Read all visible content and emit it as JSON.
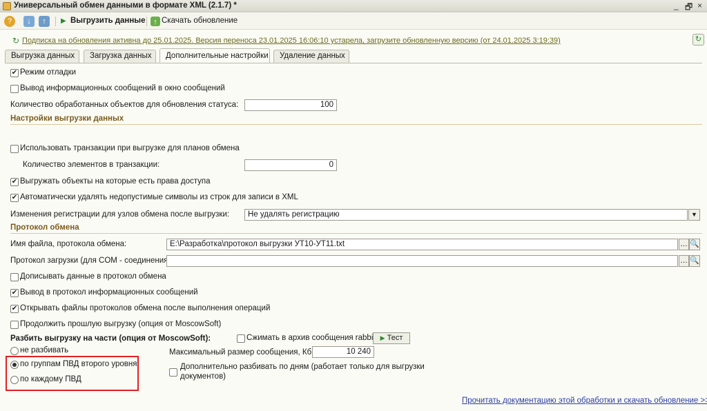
{
  "window": {
    "title": "Универсальный обмен данными в формате XML (2.1.7) *",
    "minimize_icon": "minimize-icon",
    "restore_icon": "restore-icon",
    "close_icon": "close-icon",
    "min_glyph": "_",
    "restore_glyph": "🗗",
    "close_glyph": "×"
  },
  "toolbar": {
    "export_label": "Выгрузить данные",
    "download_update_label": "Скачать обновление"
  },
  "notice": {
    "text": "Подписка на обновления активна до 25.01.2025. Версия переноса 23.01.2025 16:06:10 устарела, загрузите обновленную версию (от 24.01.2025 3:19:39)"
  },
  "tabs": [
    {
      "label": "Выгрузка данных"
    },
    {
      "label": "Загрузка данных"
    },
    {
      "label": "Дополнительные настройки"
    },
    {
      "label": "Удаление данных"
    }
  ],
  "settings": {
    "debug_mode": {
      "label": "Режим отладки",
      "checked": true
    },
    "info_messages": {
      "label": "Вывод информационных сообщений в окно сообщений",
      "checked": false
    },
    "processed_count": {
      "label": "Количество обработанных объектов для обновления статуса:",
      "value": "100"
    }
  },
  "export_settings": {
    "header": "Настройки выгрузки данных",
    "use_transactions": {
      "label": "Использовать транзакции при выгрузке для планов обмена",
      "checked": false
    },
    "transaction_items": {
      "label": "Количество элементов в транзакции:",
      "value": "0"
    },
    "export_with_rights": {
      "label": "Выгружать объекты на которые есть права доступа",
      "checked": true
    },
    "remove_invalid_chars": {
      "label": "Автоматически удалять недопустимые символы из строк для записи в XML",
      "checked": true
    },
    "registration_changes": {
      "label": "Изменения регистрации для узлов обмена после выгрузки:",
      "value": "Не удалять регистрацию"
    }
  },
  "protocol": {
    "header": "Протокол обмена",
    "file_name": {
      "label": "Имя файла, протокола обмена:",
      "value": "E:\\Разработка\\протокол выгрузки УТ10-УТ11.txt"
    },
    "com_protocol": {
      "label": "Протокол загрузки (для COM - соединения):",
      "value": ""
    },
    "append_data": {
      "label": "Дописывать данные в протокол обмена",
      "checked": false
    },
    "info_to_protocol": {
      "label": "Вывод в протокол информационных сообщений",
      "checked": true
    },
    "open_files": {
      "label": "Открывать файлы протоколов обмена после выполнения операций",
      "checked": true
    },
    "continue_export": {
      "label": "Продолжить прошлую выгрузку (опция от MoscowSoft)",
      "checked": false
    }
  },
  "split": {
    "header": "Разбить выгрузку на части (опция от MoscowSoft):",
    "options": [
      {
        "label": "не разбивать",
        "selected": false
      },
      {
        "label": "по группам ПВД второго уровня",
        "selected": true
      },
      {
        "label": "по каждому ПВД",
        "selected": false
      }
    ],
    "compress": {
      "label": "Сжимать в архив сообщения rabbit M",
      "checked": false
    },
    "test_button": "Тест",
    "max_size": {
      "label": "Максимальный размер сообщения, Кб:",
      "value": "10 240"
    },
    "split_by_days": {
      "label_line1": "Дополнительно разбивать по дням (работает только для выгрузки",
      "label_line2": "документов)",
      "checked": false
    }
  },
  "footer": {
    "doc_link": "Прочитать документацию этой обработки и скачать обновление >>"
  },
  "colors": {
    "section_header": "#7a5c1e",
    "link": "#2a3da0",
    "highlight_frame": "#e02020"
  }
}
